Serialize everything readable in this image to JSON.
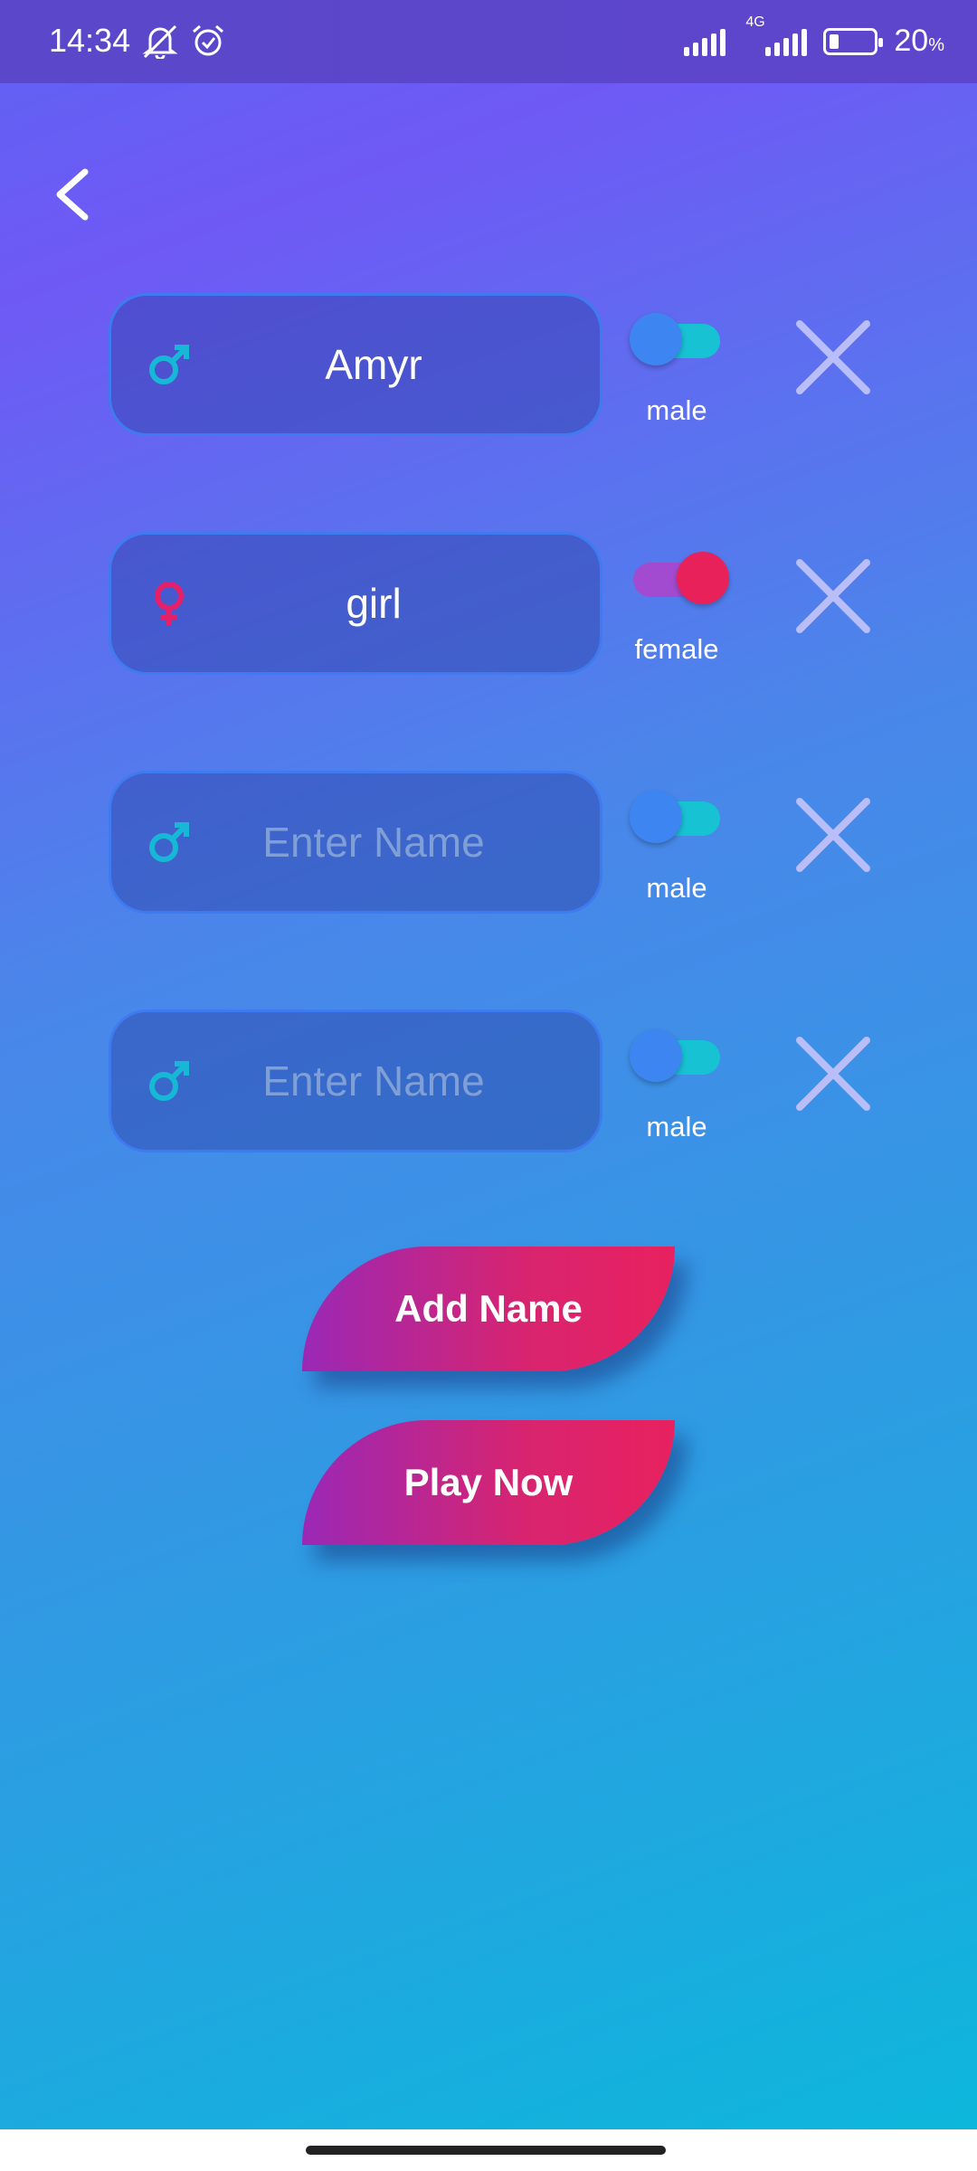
{
  "status_bar": {
    "time": "14:34",
    "network_label": "4G",
    "battery": "20",
    "battery_unit": "%"
  },
  "players": [
    {
      "name": "Amyr",
      "placeholder": "Enter Name",
      "gender": "male",
      "gender_label": "male"
    },
    {
      "name": "girl",
      "placeholder": "Enter Name",
      "gender": "female",
      "gender_label": "female"
    },
    {
      "name": "",
      "placeholder": "Enter Name",
      "gender": "male",
      "gender_label": "male"
    },
    {
      "name": "",
      "placeholder": "Enter Name",
      "gender": "male",
      "gender_label": "male"
    }
  ],
  "buttons": {
    "add_name": "Add Name",
    "play_now": "Play Now"
  },
  "colors": {
    "male_icon": "#17b7d6",
    "female_icon": "#e4206b",
    "button_start": "#9a28b6",
    "button_end": "#e8215f"
  }
}
